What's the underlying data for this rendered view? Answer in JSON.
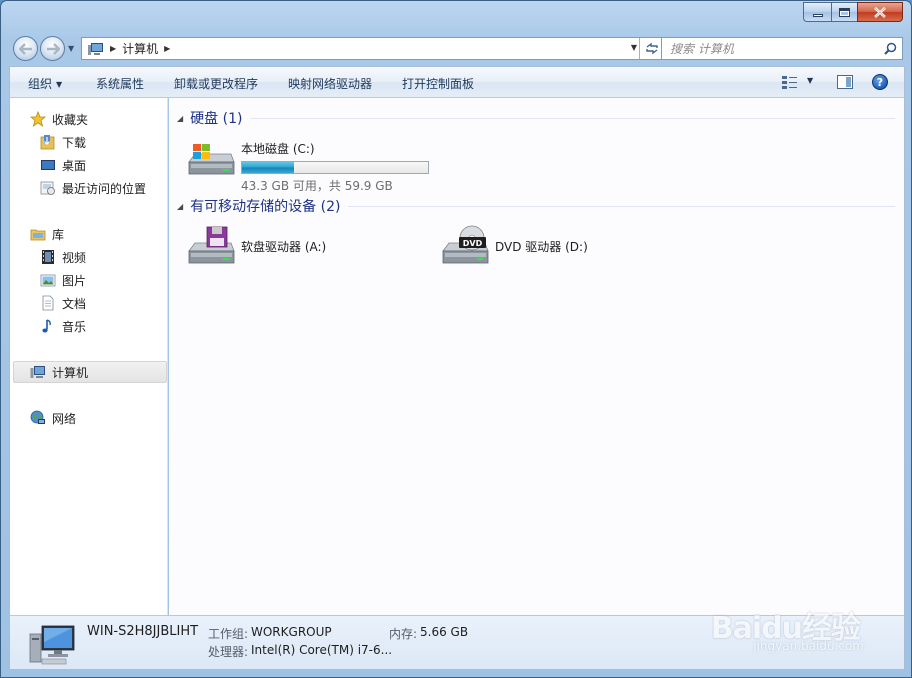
{
  "window": {
    "caption": {
      "minimize": "—",
      "maximize": "□",
      "close": "✕"
    }
  },
  "address_bar": {
    "path": "计算机",
    "search_placeholder": "搜索 计算机"
  },
  "toolbar": {
    "organize": "组织",
    "system_properties": "系统属性",
    "uninstall": "卸载或更改程序",
    "map_drive": "映射网络驱动器",
    "control_panel": "打开控制面板",
    "help": "?"
  },
  "navigation": {
    "favorites": {
      "label": "收藏夹",
      "items": [
        "下载",
        "桌面",
        "最近访问的位置"
      ]
    },
    "libraries": {
      "label": "库",
      "items": [
        "视频",
        "图片",
        "文档",
        "音乐"
      ]
    },
    "computer": "计算机",
    "network": "网络"
  },
  "content": {
    "hard_disks": {
      "header": "硬盘 (1)",
      "drives": [
        {
          "name": "本地磁盘 (C:)",
          "space": "43.3 GB 可用，共 59.9 GB",
          "used_fraction": 0.277
        }
      ]
    },
    "removable": {
      "header": "有可移动存储的设备 (2)",
      "drives": [
        {
          "name": "软盘驱动器 (A:)"
        },
        {
          "name": "DVD 驱动器 (D:)",
          "badge": "DVD"
        }
      ]
    }
  },
  "details": {
    "computer_name": "WIN-S2H8JJBLIHT",
    "workgroup_label": "工作组:",
    "workgroup": "WORKGROUP",
    "memory_label": "内存:",
    "memory": "5.66 GB",
    "processor_label": "处理器:",
    "processor": "Intel(R) Core(TM) i7-6..."
  },
  "watermark": {
    "brand": "Baidu经验",
    "url": "jingyan.baidu.com"
  },
  "colors": {
    "accent": "#1e3287",
    "usage_bar": "#27a3cf",
    "frame": "#a9c8e8"
  }
}
